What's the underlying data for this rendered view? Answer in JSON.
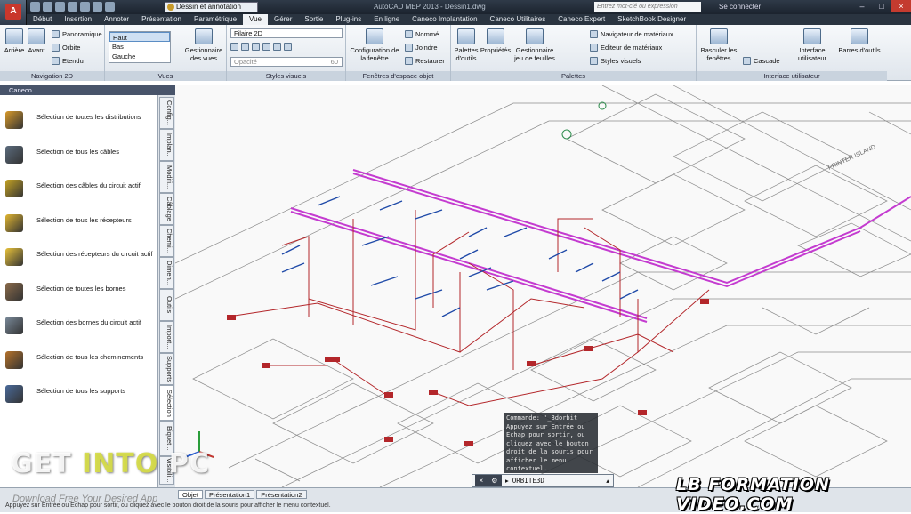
{
  "titlebar": {
    "app_letter": "A",
    "workspace": "Dessin et annotation",
    "window_title": "AutoCAD MEP 2013 - Dessin1.dwg",
    "search_placeholder": "Entrez mot-clé ou expression",
    "signin": "Se connecter"
  },
  "tabs": [
    "Début",
    "Insertion",
    "Annoter",
    "Présentation",
    "Paramétrique",
    "Vue",
    "Gérer",
    "Sortie",
    "Plug-ins",
    "En ligne",
    "Caneco Implantation",
    "Caneco Utilitaires",
    "Caneco Expert",
    "SketchBook Designer"
  ],
  "ribbon": {
    "nav2d": {
      "title": "Navigation 2D",
      "arriere": "Arrière",
      "avant": "Avant",
      "panoramique": "Panoramique",
      "orbite": "Orbite",
      "etendu": "Etendu"
    },
    "vues": {
      "title": "Vues",
      "items": [
        "Haut",
        "Bas",
        "Gauche"
      ],
      "gestionnaire": "Gestionnaire des vues"
    },
    "styles": {
      "title": "Styles visuels",
      "style": "Filaire 2D",
      "opacity_label": "Opacité",
      "opacity_value": "60"
    },
    "fenetres": {
      "title": "Fenêtres d'espace objet",
      "configuration": "Configuration de la fenêtre",
      "nomme": "Nommé",
      "joindre": "Joindre",
      "restaurer": "Restaurer"
    },
    "palettes": {
      "title": "Palettes",
      "palettes_outils": "Palettes d'outils",
      "proprietes": "Propriétés",
      "gestionnaire_jeu": "Gestionnaire jeu de feuilles",
      "navigateur": "Navigateur de matériaux",
      "editeur": "Editeur de matériaux",
      "styles_visuels": "Styles visuels"
    },
    "interface": {
      "title": "Interface utilisateur",
      "basculer": "Basculer les fenêtres",
      "cascade": "Cascade",
      "interface_utilisateur": "Interface utilisateur",
      "barres": "Barres d'outils"
    }
  },
  "palette": {
    "title": "Caneco",
    "items": [
      "Sélection de toutes les distributions",
      "Sélection de tous les câbles",
      "Sélection des câbles du circuit actif",
      "Sélection de tous les récepteurs",
      "Sélection des récepteurs du circuit actif",
      "Sélection de toutes les bornes",
      "Sélection des bornes du circuit actif",
      "Sélection de tous les cheminements",
      "Sélection de tous les supports"
    ],
    "vtabs": [
      "Config...",
      "Implan...",
      "Modifi...",
      "Câblage",
      "Chemi...",
      "Dimen...",
      "Outils",
      "Import...",
      "Supports",
      "Sélection",
      "Biquet...",
      "Visibili..."
    ]
  },
  "drawing": {
    "plan_label": "PRINTER ISLAND"
  },
  "command": {
    "history": "Commande: '_3dorbit\nAppuyez sur Entrée ou\nEchap pour sortir, ou\ncliquez avec le bouton\ndroit de la souris pour\nafficher le menu\ncontextuel.",
    "input": "ORBITE3D"
  },
  "status": {
    "layouts": [
      "Objet",
      "Présentation1",
      "Présentation2"
    ],
    "text": "Appuyez sur Entrée ou Echap pour sortir, ou cliquez avec le bouton droit de la souris pour afficher le menu contextuel."
  },
  "watermarks": {
    "get": "GET ",
    "into": "INTO ",
    "pc": "PC",
    "tagline": "Download Free Your Desired App",
    "brand": "LB FORMATION VIDEO.COM"
  },
  "colors": {
    "magenta": "#c43bd0",
    "red": "#b3262a",
    "blue": "#1f4aa8",
    "accent": "#c43b2f"
  }
}
